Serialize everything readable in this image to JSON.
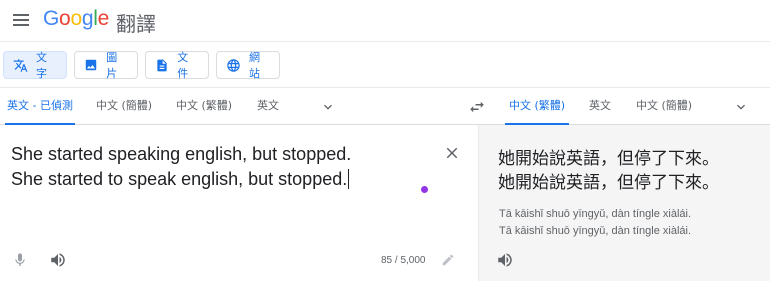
{
  "header": {
    "logo_letters": [
      "G",
      "o",
      "o",
      "g",
      "l",
      "e"
    ],
    "product": "翻譯"
  },
  "modes": [
    {
      "label": "文字",
      "icon": "translate-icon",
      "active": true
    },
    {
      "label": "圖片",
      "icon": "image-icon",
      "active": false
    },
    {
      "label": "文件",
      "icon": "document-icon",
      "active": false
    },
    {
      "label": "網站",
      "icon": "globe-icon",
      "active": false
    }
  ],
  "source_langs": [
    "英文 - 已偵測",
    "中文 (簡體)",
    "中文 (繁體)",
    "英文"
  ],
  "target_langs": [
    "中文 (繁體)",
    "英文",
    "中文 (簡體)"
  ],
  "source": {
    "lines": [
      "She started speaking english, but stopped.",
      "She started to speak english, but stopped."
    ],
    "char_count": "85 / 5,000"
  },
  "target": {
    "lines": [
      "她開始說英語，但停了下來。",
      "她開始說英語，但停了下來。"
    ],
    "romanization": [
      "Tā kāishǐ shuō yīngyǔ, dàn tíngle xiàlái.",
      "Tā kāishǐ shuō yīngyǔ, dàn tíngle xiàlái."
    ]
  },
  "colors": {
    "accent": "#1a73e8",
    "active_bg": "#e8f0fe",
    "target_bg": "#f5f5f5",
    "dot": "#9334e6"
  }
}
